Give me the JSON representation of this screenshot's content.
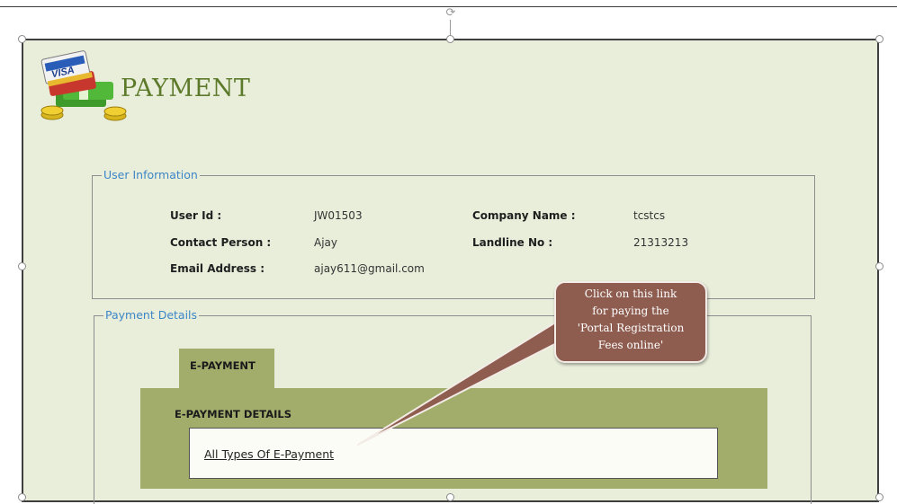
{
  "header": {
    "title": "PAYMENT",
    "logo_text": "VISA"
  },
  "user_info": {
    "legend": "User Information",
    "fields": [
      {
        "label": "User Id :",
        "value": "JW01503"
      },
      {
        "label": "Company Name :",
        "value": "tcstcs"
      },
      {
        "label": "Contact Person :",
        "value": "Ajay"
      },
      {
        "label": "Landline No :",
        "value": "21313213"
      },
      {
        "label": "Email Address :",
        "value": "ajay611@gmail.com"
      }
    ]
  },
  "payment_details": {
    "legend": "Payment Details",
    "tab_label": "E-PAYMENT",
    "panel_title": "E-PAYMENT DETAILS",
    "link_text": "All Types Of E-Payment"
  },
  "callout": {
    "lines": [
      "Click on this link",
      "for paying the",
      "'Portal Registration",
      "Fees online'"
    ]
  },
  "colors": {
    "background": "#e9eedb",
    "title_green": "#5c7a2a",
    "legend_blue": "#3d86c6",
    "panel_olive": "#a2ad6c",
    "callout_brown": "#8e5d50"
  }
}
